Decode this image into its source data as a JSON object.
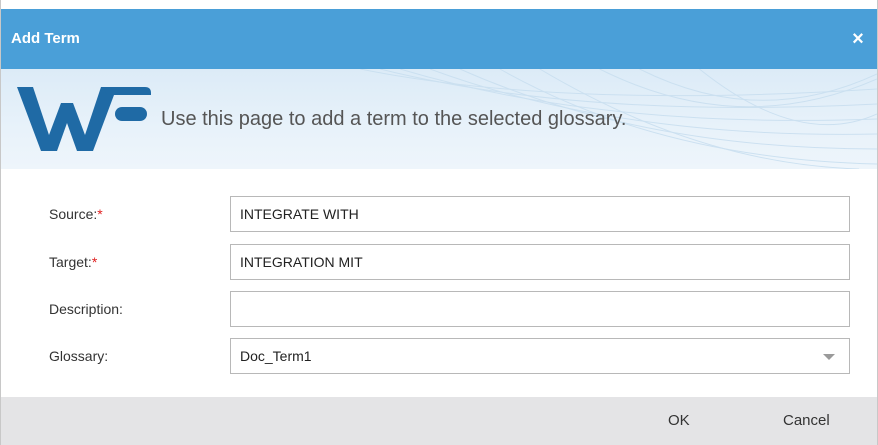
{
  "dialog": {
    "title": "Add Term",
    "close_symbol": "×"
  },
  "banner": {
    "message": "Use this page to add a term to the selected glossary.",
    "logo": "wf-logo"
  },
  "form": {
    "required_marker": "*",
    "source": {
      "label": "Source:",
      "value": "INTEGRATE WITH"
    },
    "target": {
      "label": "Target:",
      "value": "INTEGRATION MIT"
    },
    "description": {
      "label": "Description:",
      "value": ""
    },
    "glossary": {
      "label": "Glossary:",
      "value": "Doc_Term1"
    }
  },
  "footer": {
    "ok_label": "OK",
    "cancel_label": "Cancel"
  },
  "colors": {
    "titlebar": "#4a9fd8",
    "logo_blue": "#1f6aa5",
    "required": "#e02020",
    "footer": "#e4e4e6"
  }
}
